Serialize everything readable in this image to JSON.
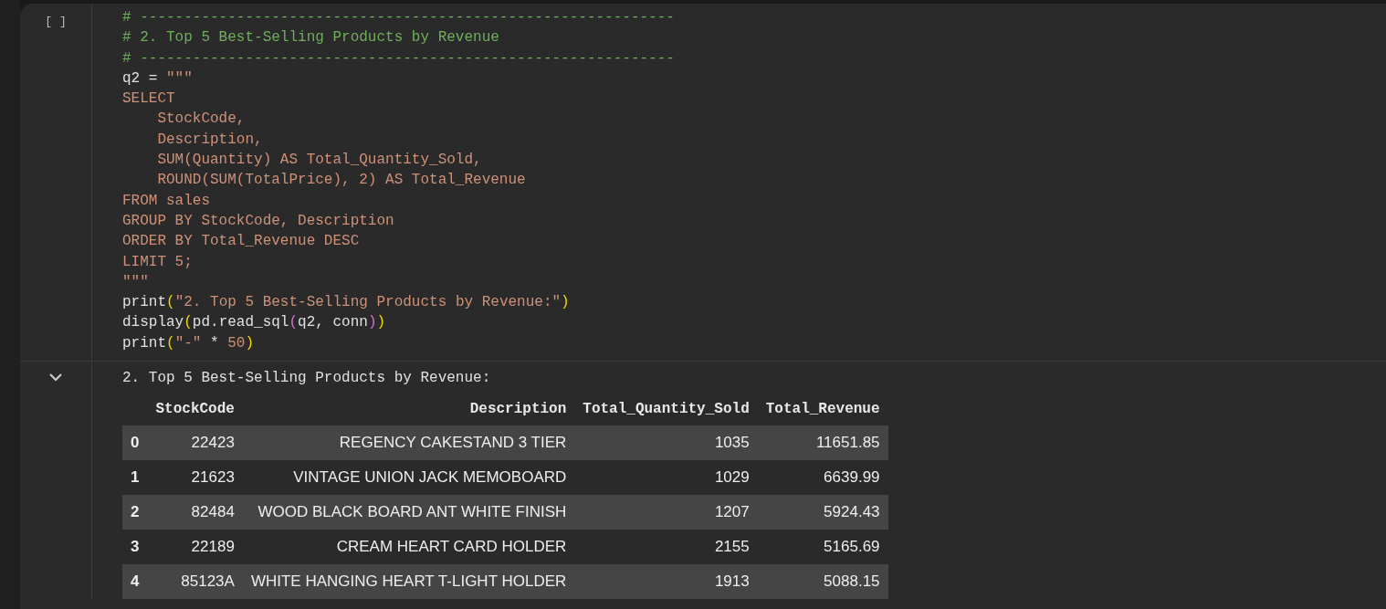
{
  "cell": {
    "run_indicator": "[ ]",
    "code_lines": [
      [
        {
          "kind": "comment",
          "text": "# -------------------------------------------------------------"
        }
      ],
      [
        {
          "kind": "comment",
          "text": "# 2. Top 5 Best-Selling Products by Revenue"
        }
      ],
      [
        {
          "kind": "comment",
          "text": "# -------------------------------------------------------------"
        }
      ],
      [
        {
          "kind": "plain",
          "text": "q2 = "
        },
        {
          "kind": "string",
          "text": "\"\"\""
        }
      ],
      [
        {
          "kind": "string",
          "text": "SELECT"
        }
      ],
      [
        {
          "kind": "string",
          "text": "    StockCode,"
        }
      ],
      [
        {
          "kind": "string",
          "text": "    Description,"
        }
      ],
      [
        {
          "kind": "string",
          "text": "    SUM(Quantity) AS Total_Quantity_Sold,"
        }
      ],
      [
        {
          "kind": "string",
          "text": "    ROUND(SUM(TotalPrice), 2) AS Total_Revenue"
        }
      ],
      [
        {
          "kind": "string",
          "text": "FROM sales"
        }
      ],
      [
        {
          "kind": "string",
          "text": "GROUP BY StockCode, Description"
        }
      ],
      [
        {
          "kind": "string",
          "text": "ORDER BY Total_Revenue DESC"
        }
      ],
      [
        {
          "kind": "string",
          "text": "LIMIT 5;"
        }
      ],
      [
        {
          "kind": "string",
          "text": "\"\"\""
        }
      ],
      [
        {
          "kind": "plain",
          "text": "print"
        },
        {
          "kind": "bracket1",
          "text": "("
        },
        {
          "kind": "string",
          "text": "\"2. Top 5 Best-Selling Products by Revenue:\""
        },
        {
          "kind": "bracket1",
          "text": ")"
        }
      ],
      [
        {
          "kind": "plain",
          "text": "display"
        },
        {
          "kind": "bracket1",
          "text": "("
        },
        {
          "kind": "plain",
          "text": "pd.read_sql"
        },
        {
          "kind": "bracket2",
          "text": "("
        },
        {
          "kind": "plain",
          "text": "q2, conn"
        },
        {
          "kind": "bracket2",
          "text": ")"
        },
        {
          "kind": "bracket1",
          "text": ")"
        }
      ],
      [
        {
          "kind": "plain",
          "text": "print"
        },
        {
          "kind": "bracket1",
          "text": "("
        },
        {
          "kind": "string",
          "text": "\"-\""
        },
        {
          "kind": "plain",
          "text": " * "
        },
        {
          "kind": "number",
          "text": "50"
        },
        {
          "kind": "bracket1",
          "text": ")"
        }
      ]
    ]
  },
  "output": {
    "expanded": true,
    "text": "2. Top 5 Best-Selling Products by Revenue:",
    "table": {
      "columns": [
        "StockCode",
        "Description",
        "Total_Quantity_Sold",
        "Total_Revenue"
      ],
      "rows": [
        {
          "index": "0",
          "cells": [
            "22423",
            "REGENCY CAKESTAND 3 TIER",
            "1035",
            "11651.85"
          ]
        },
        {
          "index": "1",
          "cells": [
            "21623",
            "VINTAGE UNION JACK MEMOBOARD",
            "1029",
            "6639.99"
          ]
        },
        {
          "index": "2",
          "cells": [
            "82484",
            "WOOD BLACK BOARD ANT WHITE FINISH",
            "1207",
            "5924.43"
          ]
        },
        {
          "index": "3",
          "cells": [
            "22189",
            "CREAM HEART CARD HOLDER",
            "2155",
            "5165.69"
          ]
        },
        {
          "index": "4",
          "cells": [
            "85123A",
            "WHITE HANGING HEART T-LIGHT HOLDER",
            "1913",
            "5088.15"
          ]
        }
      ]
    }
  }
}
